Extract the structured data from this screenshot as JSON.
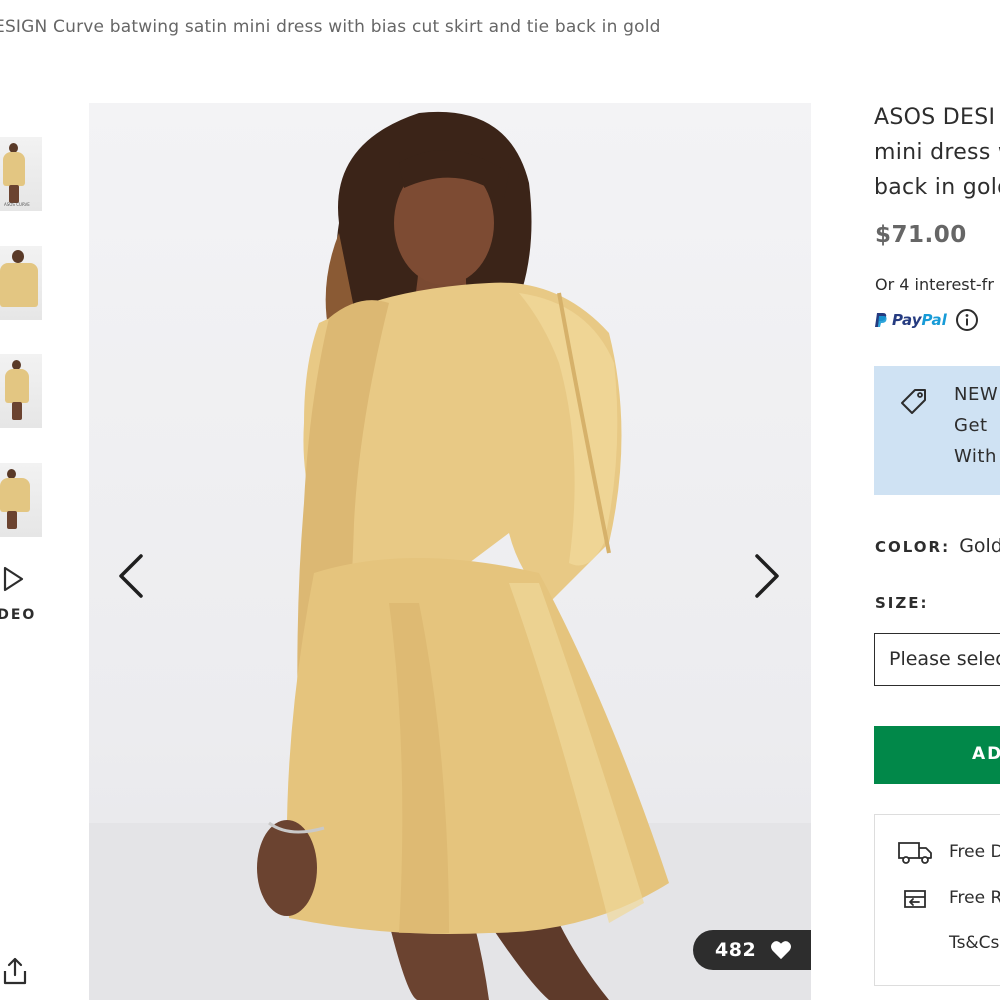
{
  "breadcrumb": {
    "text": "ESIGN Curve batwing satin mini dress with bias cut skirt and tie back in gold"
  },
  "gallery": {
    "thumbnails": [
      {
        "name": "thumbnail-1",
        "caption": "ASOS CURVE"
      },
      {
        "name": "thumbnail-2",
        "caption": ""
      },
      {
        "name": "thumbnail-3",
        "caption": ""
      },
      {
        "name": "thumbnail-4",
        "caption": ""
      }
    ],
    "video_label": "IDEO",
    "save_count": "482"
  },
  "product": {
    "title_lines": [
      "ASOS DESI",
      "mini dress w",
      "back in gold"
    ],
    "price": "$71.00",
    "installments_text": "Or 4 interest-fr",
    "paypal": {
      "pay": "Pay",
      "pal": "Pal"
    },
    "promo_lines": [
      "NEW",
      "Get",
      "With"
    ],
    "color_label": "COLOR:",
    "color_value": "Gold",
    "size_label": "SIZE:",
    "size_placeholder": "Please selec",
    "add_button_label": "AD",
    "delivery": [
      {
        "icon": "truck-icon",
        "text": "Free D"
      },
      {
        "icon": "return-box-icon",
        "text": "Free R"
      },
      {
        "icon": "",
        "text": "Ts&Cs"
      }
    ]
  },
  "colors": {
    "add_button": "#018849",
    "promo_bg": "#cfe2f3",
    "dress": "#e8c985",
    "text": "#2d2d2d"
  }
}
